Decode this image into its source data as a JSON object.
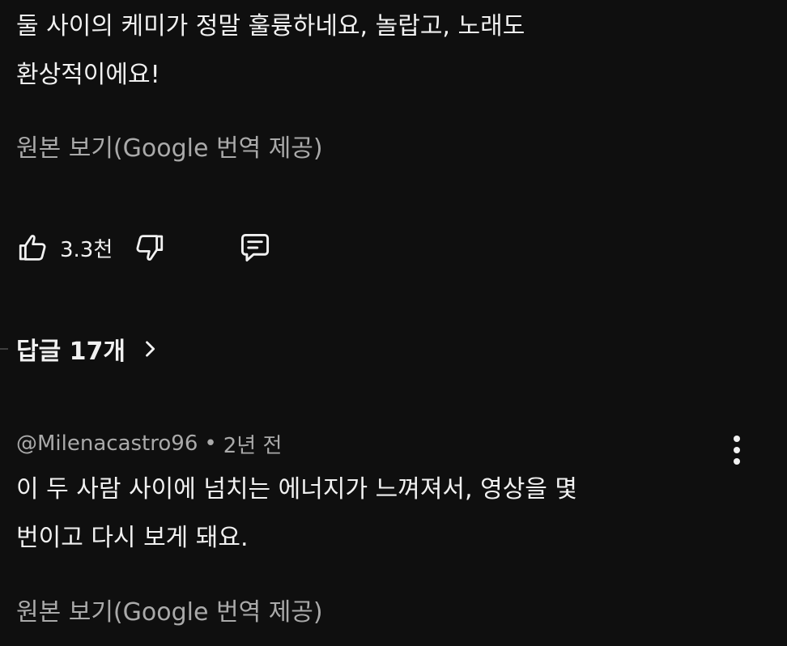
{
  "comment1": {
    "line1": "둘 사이의 케미가 정말 훌륭하네요, 놀랍고, 노래도",
    "line2": "환상적이에요!",
    "translate_link": "원본 보기(Google 번역 제공)"
  },
  "actions": {
    "like_count": "3.3천"
  },
  "replies": {
    "label": "답글 17개"
  },
  "comment2": {
    "author": "@Milenacastro96",
    "separator": "•",
    "time": "2년 전",
    "line1": "이 두 사람 사이에 넘치는 에너지가 느껴져서, 영상을 몇",
    "line2": "번이고 다시 보게 돼요.",
    "translate_link": "원본 보기(Google 번역 제공)"
  },
  "icons": {
    "like": "thumb-up-icon",
    "dislike": "thumb-down-icon",
    "reply": "comment-icon",
    "expand": "chevron-right-icon",
    "more": "more-vert-icon"
  },
  "colors": {
    "background": "#0f0f0f",
    "primary_text": "#f1f1f1",
    "secondary_text": "#aaaaaa"
  }
}
